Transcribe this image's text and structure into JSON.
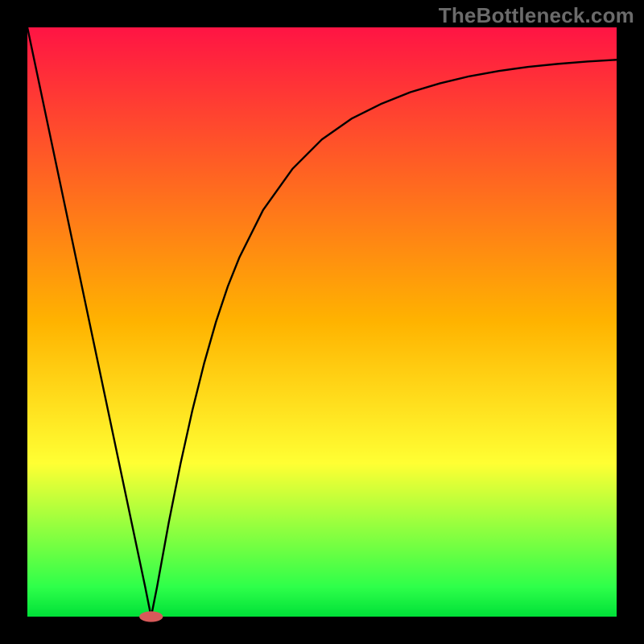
{
  "watermark": "TheBottleneck.com",
  "chart_data": {
    "type": "line",
    "title": "",
    "xlabel": "",
    "ylabel": "",
    "xlim": [
      0,
      100
    ],
    "ylim": [
      0,
      100
    ],
    "grid": false,
    "legend": false,
    "background_gradient": [
      {
        "pos": 0.0,
        "color": "#ff1444"
      },
      {
        "pos": 0.5,
        "color": "#ffb300"
      },
      {
        "pos": 0.74,
        "color": "#ffff33"
      },
      {
        "pos": 0.95,
        "color": "#2eff4a"
      },
      {
        "pos": 1.0,
        "color": "#00e038"
      }
    ],
    "series": [
      {
        "name": "bottleneck-curve",
        "x": [
          0,
          2,
          4,
          6,
          8,
          10,
          12,
          14,
          16,
          18,
          20,
          21,
          22,
          24,
          26,
          28,
          30,
          32,
          34,
          36,
          40,
          45,
          50,
          55,
          60,
          65,
          70,
          75,
          80,
          85,
          90,
          95,
          100
        ],
        "y": [
          100,
          90.5,
          81,
          71.5,
          62,
          52.5,
          43,
          33.5,
          24,
          14.5,
          5,
          0,
          5,
          16,
          26,
          35,
          43,
          50,
          56,
          61,
          69,
          76,
          81,
          84.5,
          87,
          89,
          90.5,
          91.7,
          92.6,
          93.3,
          93.8,
          94.2,
          94.5
        ]
      }
    ],
    "marker": {
      "name": "optimal-point",
      "x": 21,
      "y": 0,
      "color": "#d85a5a",
      "rx": 2.0,
      "ry": 0.9
    },
    "frame": {
      "stroke": "#000000",
      "fill_outside": "#000000"
    }
  }
}
